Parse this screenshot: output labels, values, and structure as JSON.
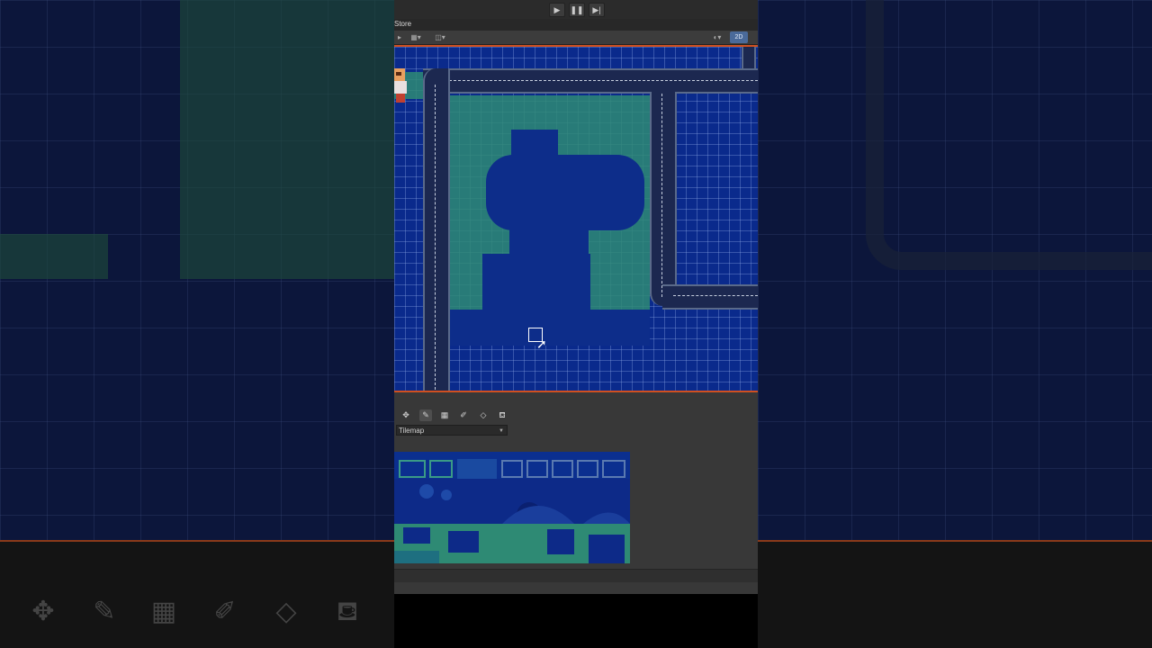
{
  "window": {
    "scene_tab_title": "Store",
    "mode_2d_label": "2D"
  },
  "playbar": {
    "play_icon": "▶",
    "pause_icon": "❚❚",
    "step_icon": "▶|"
  },
  "toolbar": {
    "icons": [
      "sidebar-toggle-icon",
      "grid-icon",
      "view-options-icon",
      "render-mode-icon"
    ]
  },
  "palette": {
    "tool_icons": [
      "move-icon",
      "brush-icon",
      "box-fill-icon",
      "picker-icon",
      "eraser-icon",
      "fill-icon"
    ],
    "active_tool": "brush-icon",
    "tilemap_select_value": "Tilemap"
  },
  "colors": {
    "scene_bg": "#0a2a8c",
    "grass": "#2e8a74",
    "road": "#1c2850",
    "accent_border": "#d05020",
    "active_2d": "#4a6a9a"
  }
}
